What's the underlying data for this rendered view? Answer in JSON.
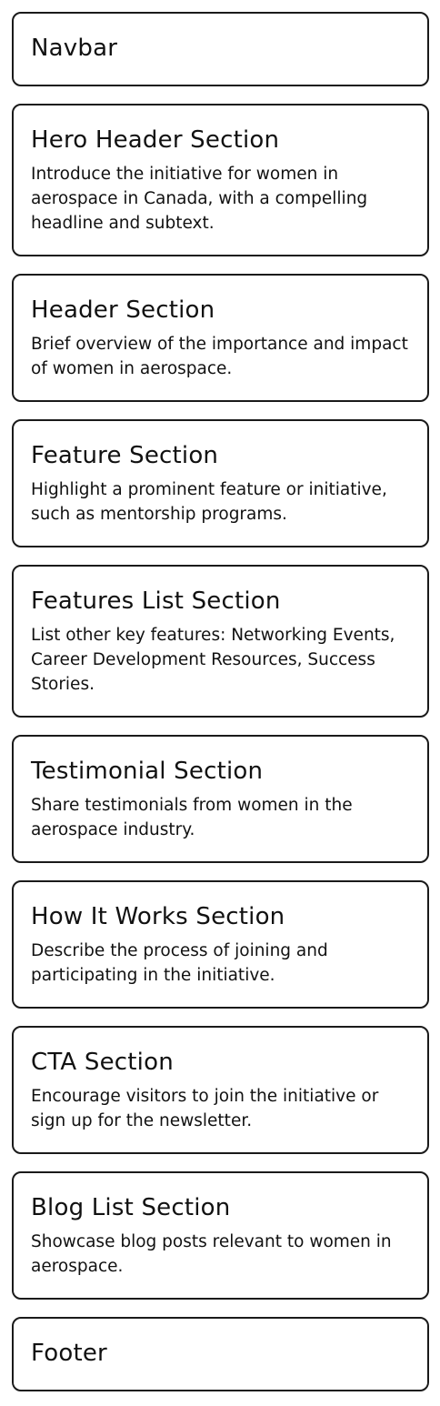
{
  "sections": [
    {
      "title": "Navbar",
      "description": ""
    },
    {
      "title": "Hero Header Section",
      "description": "Introduce the initiative for women in aerospace in Canada, with a compelling headline and subtext."
    },
    {
      "title": "Header Section",
      "description": "Brief overview of the importance and impact of women in aerospace."
    },
    {
      "title": "Feature Section",
      "description": "Highlight a prominent feature or initiative, such as mentorship programs."
    },
    {
      "title": "Features List Section",
      "description": "List other key features: Networking Events, Career Development Resources, Success Stories."
    },
    {
      "title": "Testimonial Section",
      "description": "Share testimonials from women in the aerospace industry."
    },
    {
      "title": "How It Works Section",
      "description": "Describe the process of joining and participating in the initiative."
    },
    {
      "title": "CTA Section",
      "description": "Encourage visitors to join the initiative or sign up for the newsletter."
    },
    {
      "title": "Blog List Section",
      "description": "Showcase blog posts relevant to women in aerospace."
    },
    {
      "title": "Footer",
      "description": ""
    }
  ]
}
